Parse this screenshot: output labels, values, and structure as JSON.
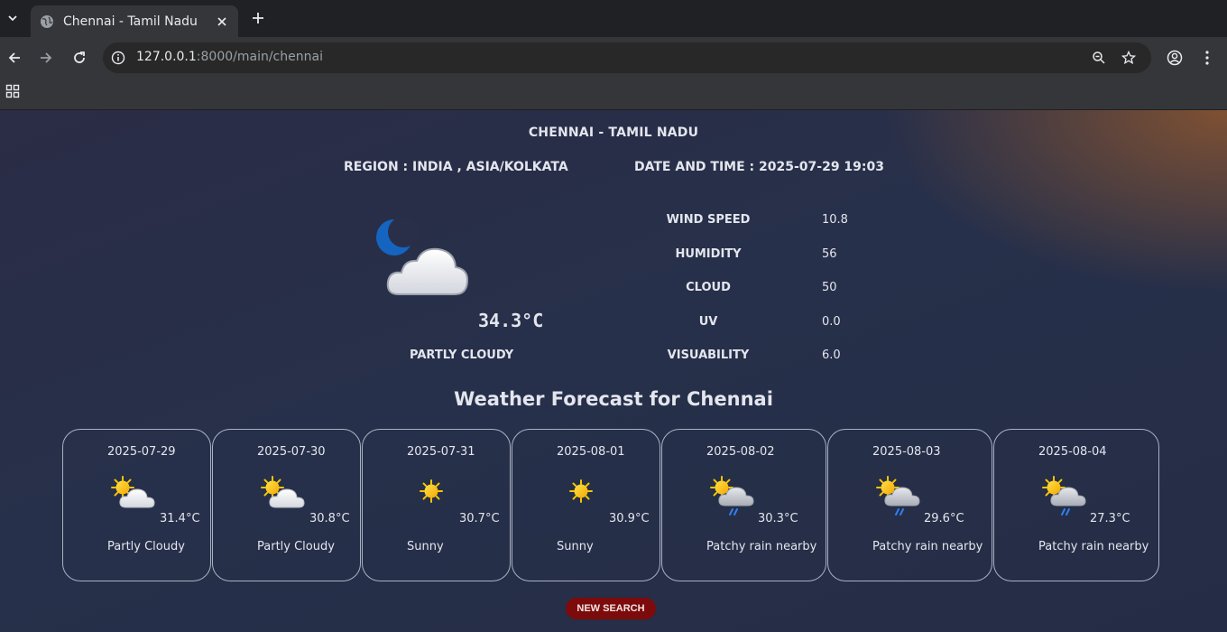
{
  "browser": {
    "tab_title": "Chennai - Tamil Nadu",
    "url_host": "127.0.0.1",
    "url_path": ":8000/main/chennai"
  },
  "weather": {
    "title": "CHENNAI - TAMIL NADU",
    "region": "REGION : INDIA , ASIA/KOLKATA",
    "datetime": "DATE AND TIME : 2025-07-29 19:03",
    "current": {
      "icon": "moon-cloud-icon",
      "temp": "34.3°C",
      "condition": "PARTLY CLOUDY"
    },
    "stats": [
      {
        "label": "WIND SPEED",
        "value": "10.8"
      },
      {
        "label": "HUMIDITY",
        "value": "56"
      },
      {
        "label": "CLOUD",
        "value": "50"
      },
      {
        "label": "UV",
        "value": "0.0"
      },
      {
        "label": "VISUABILITY",
        "value": "6.0"
      }
    ],
    "forecast_title": "Weather Forecast for Chennai",
    "forecast": [
      {
        "date": "2025-07-29",
        "icon": "sun-cloud-icon",
        "temp": "31.4°C",
        "condition": "Partly Cloudy"
      },
      {
        "date": "2025-07-30",
        "icon": "sun-cloud-icon",
        "temp": "30.8°C",
        "condition": "Partly Cloudy"
      },
      {
        "date": "2025-07-31",
        "icon": "sun-icon",
        "temp": "30.7°C",
        "condition": "Sunny"
      },
      {
        "date": "2025-08-01",
        "icon": "sun-icon",
        "temp": "30.9°C",
        "condition": "Sunny"
      },
      {
        "date": "2025-08-02",
        "icon": "sun-rain-icon",
        "temp": "30.3°C",
        "condition": "Patchy rain nearby"
      },
      {
        "date": "2025-08-03",
        "icon": "sun-rain-icon",
        "temp": "29.6°C",
        "condition": "Patchy rain nearby"
      },
      {
        "date": "2025-08-04",
        "icon": "sun-rain-icon",
        "temp": "27.3°C",
        "condition": "Patchy rain nearby"
      }
    ],
    "new_search_label": "NEW SEARCH"
  },
  "colors": {
    "button": "#7d0b0b",
    "sun": "#f7c600",
    "moon": "#1565c0"
  }
}
